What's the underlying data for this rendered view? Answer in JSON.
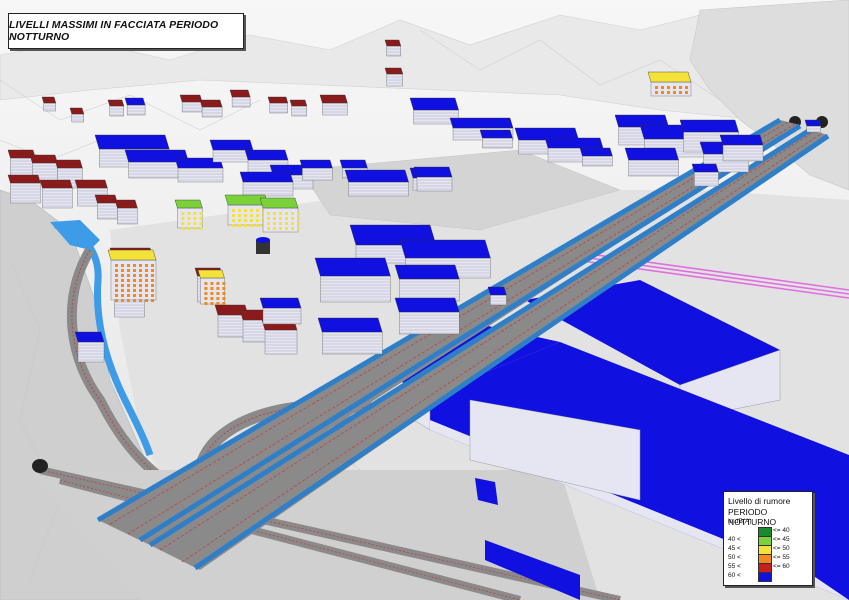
{
  "title": "LIVELLI MASSIMI IN FACCIATA PERIODO NOTTURNO",
  "legend": {
    "title": "Livello di rumore",
    "subtitle": "PERIODO NOTTURNO",
    "unit": "in dB(A)",
    "classes": [
      {
        "low": "",
        "high": "<= 40",
        "color": "#1a8a2e"
      },
      {
        "low": "40 <",
        "high": "<= 45",
        "color": "#7ad13a"
      },
      {
        "low": "45 <",
        "high": "<= 50",
        "color": "#f2e23a"
      },
      {
        "low": "50 <",
        "high": "<= 55",
        "color": "#f08a1e"
      },
      {
        "low": "55 <",
        "high": "<= 60",
        "color": "#c81e1e"
      },
      {
        "low": "60 <",
        "high": "",
        "color": "#1010e0"
      }
    ]
  },
  "colors": {
    "terrain": "#d9d9d9",
    "terrain_light": "#ececec",
    "roof_high": "#1010e0",
    "roof_mid": "#8b1a1a",
    "facade": "#e6e6f2",
    "viaduct_side": "#2f7fc8",
    "track_bed": "#8a8a8a",
    "rail": "#c04040",
    "rail_pink": "#e070e0",
    "water": "#3d9be8"
  }
}
